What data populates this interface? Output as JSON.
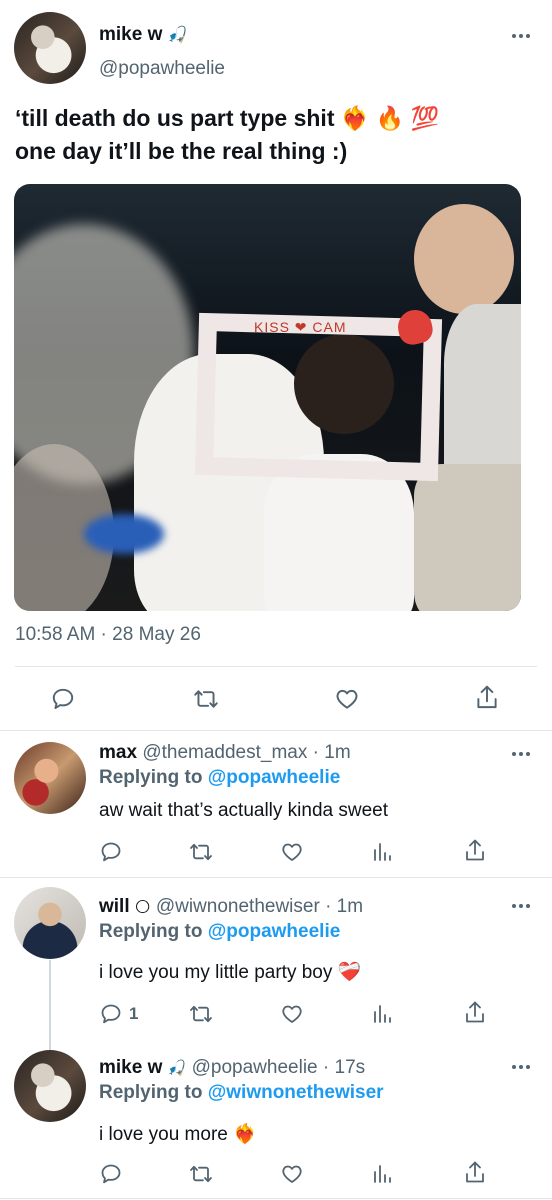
{
  "tweet": {
    "author_name": "mike w",
    "author_emoji": "🎣",
    "handle": "@popawheelie",
    "text_line1": "‘till death do us part type shit ❤️‍🔥 🔥 💯",
    "text_line2": "one day it’ll be the real thing :)",
    "timestamp": "10:58 AM · 28 May 26",
    "photo_frame_text": "KISS ❤ CAM",
    "actions": [
      "reply-icon",
      "retweet-icon",
      "like-icon",
      "share-icon"
    ]
  },
  "replies": [
    {
      "author_name": "max",
      "handle": "@themaddest_max",
      "time": "· 1m",
      "replying_label": "Replying to",
      "replying_to": "@popawheelie",
      "text": "aw wait that’s actually kinda sweet",
      "reply_count": "",
      "actions": [
        "reply-icon",
        "retweet-icon",
        "like-icon",
        "analytics-icon",
        "share-icon"
      ]
    },
    {
      "author_name": "will",
      "author_emoji": "🌕",
      "handle": "@wiwnonethewiser",
      "time": "· 1m",
      "replying_label": "Replying to",
      "replying_to": "@popawheelie",
      "text": "i love you my little party boy ❤️‍🩹",
      "reply_count": "1",
      "actions": [
        "reply-icon",
        "retweet-icon",
        "like-icon",
        "analytics-icon",
        "share-icon"
      ]
    },
    {
      "author_name": "mike w",
      "author_emoji": "🎣",
      "handle": "@popawheelie",
      "time": "· 17s",
      "replying_label": "Replying to",
      "replying_to": "@wiwnonethewiser",
      "text": "i love you more ❤️‍🔥",
      "reply_count": "",
      "actions": [
        "reply-icon",
        "retweet-icon",
        "like-icon",
        "analytics-icon",
        "share-icon"
      ]
    }
  ],
  "colors": {
    "link": "#1d9bf0",
    "muted": "#536471",
    "text": "#0f1419",
    "divider": "#e6e6e6"
  }
}
